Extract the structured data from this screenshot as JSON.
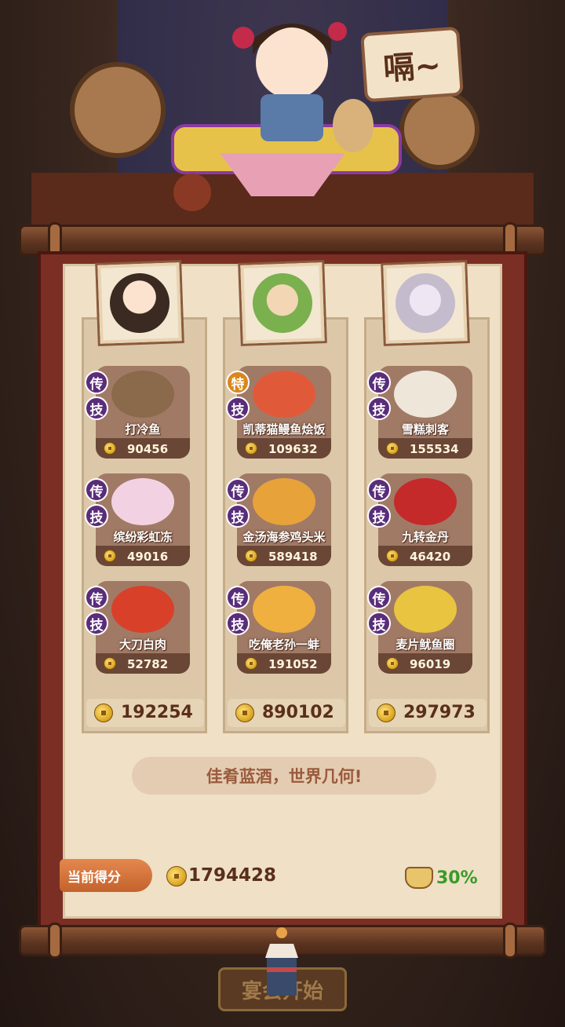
{
  "speech": "嗝~",
  "columns": [
    {
      "dishes": [
        {
          "badges": [
            "传",
            "技"
          ],
          "name": "打冷鱼",
          "price": "90456"
        },
        {
          "badges": [
            "传",
            "技"
          ],
          "name": "缤纷彩虹冻",
          "price": "49016"
        },
        {
          "badges": [
            "传",
            "技"
          ],
          "name": "大刀白肉",
          "price": "52782"
        }
      ],
      "total": "192254"
    },
    {
      "dishes": [
        {
          "badges": [
            "特",
            "技"
          ],
          "name": "凯蒂猫鳗鱼烩饭",
          "price": "109632"
        },
        {
          "badges": [
            "传",
            "技"
          ],
          "name": "金汤海参鸡头米",
          "price": "589418"
        },
        {
          "badges": [
            "传",
            "技"
          ],
          "name": "吃俺老孙一蚌",
          "price": "191052"
        }
      ],
      "total": "890102"
    },
    {
      "dishes": [
        {
          "badges": [
            "传",
            "技"
          ],
          "name": "雪糕刺客",
          "price": "155534"
        },
        {
          "badges": [
            "传",
            "技"
          ],
          "name": "九转金丹",
          "price": "46420"
        },
        {
          "badges": [
            "传",
            "技"
          ],
          "name": "麦片鱿鱼圈",
          "price": "96019"
        }
      ],
      "total": "297973"
    }
  ],
  "motto": "佳肴蓝酒，世界几何!",
  "score": {
    "label": "当前得分",
    "value": "1794428",
    "bonus": "30%"
  },
  "start_button": "宴会开始"
}
